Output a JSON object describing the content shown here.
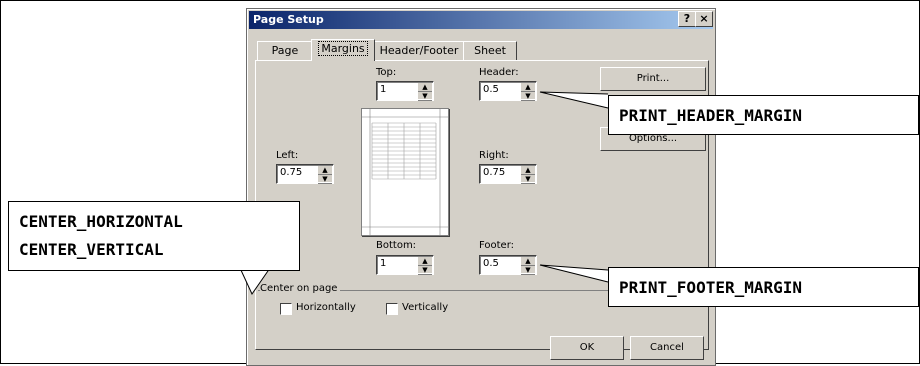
{
  "dialog": {
    "title": "Page Setup",
    "help_label": "?",
    "close_label": "×",
    "tabs": [
      {
        "label": "Page"
      },
      {
        "label": "Margins"
      },
      {
        "label": "Header/Footer"
      },
      {
        "label": "Sheet"
      }
    ],
    "fields": {
      "top": {
        "label": "Top:",
        "value": "1"
      },
      "header": {
        "label": "Header:",
        "value": "0.5"
      },
      "left": {
        "label": "Left:",
        "value": "0.75"
      },
      "right": {
        "label": "Right:",
        "value": "0.75"
      },
      "bottom": {
        "label": "Bottom:",
        "value": "1"
      },
      "footer": {
        "label": "Footer:",
        "value": "0.5"
      }
    },
    "buttons": {
      "print": "Print...",
      "options": "Options...",
      "ok": "OK",
      "cancel": "Cancel"
    },
    "center_on_page": {
      "group_label": "Center on page",
      "horizontally": "Horizontally",
      "vertically": "Vertically"
    }
  },
  "annotations": {
    "center_line1": "CENTER_HORIZONTAL",
    "center_line2": "CENTER_VERTICAL",
    "header_margin": "PRINT_HEADER_MARGIN",
    "footer_margin": "PRINT_FOOTER_MARGIN"
  }
}
